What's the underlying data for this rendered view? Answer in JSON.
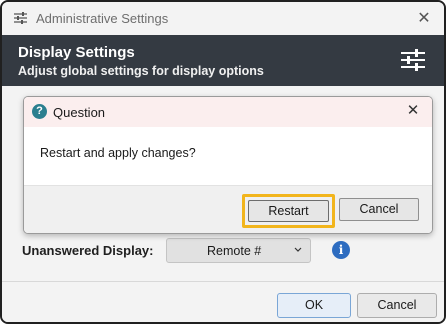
{
  "window": {
    "title": "Administrative Settings",
    "close_glyph": "✕",
    "icon": "sliders-icon"
  },
  "header": {
    "title": "Display Settings",
    "subtitle": "Adjust global settings for display options",
    "icon": "settings-sliders-icon",
    "background": "#343a42"
  },
  "form": {
    "unanswered_display": {
      "label": "Unanswered Display:",
      "value": "Remote #",
      "info_glyph": "i"
    }
  },
  "footer": {
    "ok_label": "OK",
    "cancel_label": "Cancel"
  },
  "dialog": {
    "title": "Question",
    "question_glyph": "?",
    "close_glyph": "✕",
    "message": "Restart and apply changes?",
    "restart_label": "Restart",
    "cancel_label": "Cancel",
    "highlight_color": "#f2b51c"
  }
}
